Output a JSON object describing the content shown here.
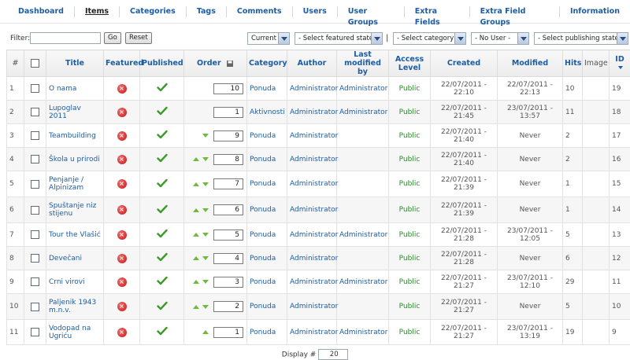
{
  "nav": {
    "items": [
      {
        "label": "Dashboard"
      },
      {
        "label": "Items",
        "active": true
      },
      {
        "label": "Categories"
      },
      {
        "label": "Tags"
      },
      {
        "label": "Comments"
      },
      {
        "label": "Users"
      },
      {
        "label": "User Groups"
      },
      {
        "label": "Extra Fields"
      },
      {
        "label": "Extra Field Groups"
      },
      {
        "label": "Information"
      }
    ]
  },
  "filters": {
    "label": "Filter:",
    "search_value": "",
    "go_label": "Go",
    "reset_label": "Reset",
    "trash_state": "Current",
    "featured_state": "- Select featured state -",
    "separator": "|",
    "category": "- Select category -",
    "author": "- No User -",
    "publishing_state": "- Select publishing state -"
  },
  "table": {
    "headers": {
      "num": "#",
      "title": "Title",
      "featured": "Featured",
      "published": "Published",
      "order": "Order",
      "category": "Category",
      "author": "Author",
      "modified_by": "Last modified by",
      "access": "Access Level",
      "created": "Created",
      "modified": "Modified",
      "hits": "Hits",
      "image": "Image",
      "id": "ID"
    },
    "rows": [
      {
        "num": "1",
        "title": "O nama",
        "order": "10",
        "up": false,
        "down": false,
        "category": "Ponuda",
        "author": "Administrator",
        "modified_by": "Administrator",
        "access": "Public",
        "created": "22/07/2011 - 22:10",
        "modified": "22/07/2011 - 22:13",
        "hits": "10",
        "id": "19"
      },
      {
        "num": "2",
        "title": "Lupoglav 2011",
        "order": "1",
        "up": false,
        "down": false,
        "category": "Aktivnosti",
        "author": "Administrator",
        "modified_by": "Administrator",
        "access": "Public",
        "created": "22/07/2011 - 21:45",
        "modified": "23/07/2011 - 13:57",
        "hits": "11",
        "id": "18"
      },
      {
        "num": "3",
        "title": "Teambuilding",
        "order": "9",
        "up": false,
        "down": true,
        "category": "Ponuda",
        "author": "Administrator",
        "modified_by": "",
        "access": "Public",
        "created": "22/07/2011 - 21:40",
        "modified": "Never",
        "hits": "2",
        "id": "17"
      },
      {
        "num": "4",
        "title": "Škola u prirodi",
        "order": "8",
        "up": true,
        "down": true,
        "category": "Ponuda",
        "author": "Administrator",
        "modified_by": "",
        "access": "Public",
        "created": "22/07/2011 - 21:40",
        "modified": "Never",
        "hits": "2",
        "id": "16"
      },
      {
        "num": "5",
        "title": "Penjanje / Alpinizam",
        "order": "7",
        "up": true,
        "down": true,
        "category": "Ponuda",
        "author": "Administrator",
        "modified_by": "",
        "access": "Public",
        "created": "22/07/2011 - 21:39",
        "modified": "Never",
        "hits": "1",
        "id": "15"
      },
      {
        "num": "6",
        "title": "Spuštanje niz stijenu",
        "order": "6",
        "up": true,
        "down": true,
        "category": "Ponuda",
        "author": "Administrator",
        "modified_by": "",
        "access": "Public",
        "created": "22/07/2011 - 21:39",
        "modified": "Never",
        "hits": "1",
        "id": "14"
      },
      {
        "num": "7",
        "title": "Tour the Vlašić",
        "order": "5",
        "up": true,
        "down": true,
        "category": "Ponuda",
        "author": "Administrator",
        "modified_by": "Administrator",
        "access": "Public",
        "created": "22/07/2011 - 21:28",
        "modified": "23/07/2011 - 12:05",
        "hits": "5",
        "id": "13"
      },
      {
        "num": "8",
        "title": "Devečani",
        "order": "4",
        "up": true,
        "down": true,
        "category": "Ponuda",
        "author": "Administrator",
        "modified_by": "",
        "access": "Public",
        "created": "22/07/2011 - 21:28",
        "modified": "Never",
        "hits": "6",
        "id": "12"
      },
      {
        "num": "9",
        "title": "Crni virovi",
        "order": "3",
        "up": true,
        "down": true,
        "category": "Ponuda",
        "author": "Administrator",
        "modified_by": "Administrator",
        "access": "Public",
        "created": "22/07/2011 - 21:27",
        "modified": "23/07/2011 - 12:10",
        "hits": "29",
        "id": "11"
      },
      {
        "num": "10",
        "title": "Paljenik 1943 m.n.v.",
        "order": "2",
        "up": true,
        "down": true,
        "category": "Ponuda",
        "author": "Administrator",
        "modified_by": "",
        "access": "Public",
        "created": "22/07/2011 - 21:27",
        "modified": "Never",
        "hits": "5",
        "id": "10"
      },
      {
        "num": "11",
        "title": "Vodopad na Ugriću",
        "order": "1",
        "up": true,
        "down": false,
        "category": "Ponuda",
        "author": "Administrator",
        "modified_by": "Administrator",
        "access": "Public",
        "created": "22/07/2011 - 21:27",
        "modified": "23/07/2011 - 13:19",
        "hits": "19",
        "id": "9"
      }
    ]
  },
  "footer": {
    "display_label": "Display #",
    "display_value": "20"
  },
  "icons": {
    "unpublished": "x-icon",
    "published": "check-icon",
    "order_up": "up-arrow-icon",
    "order_down": "down-arrow-icon",
    "save_order": "save-order-icon"
  }
}
